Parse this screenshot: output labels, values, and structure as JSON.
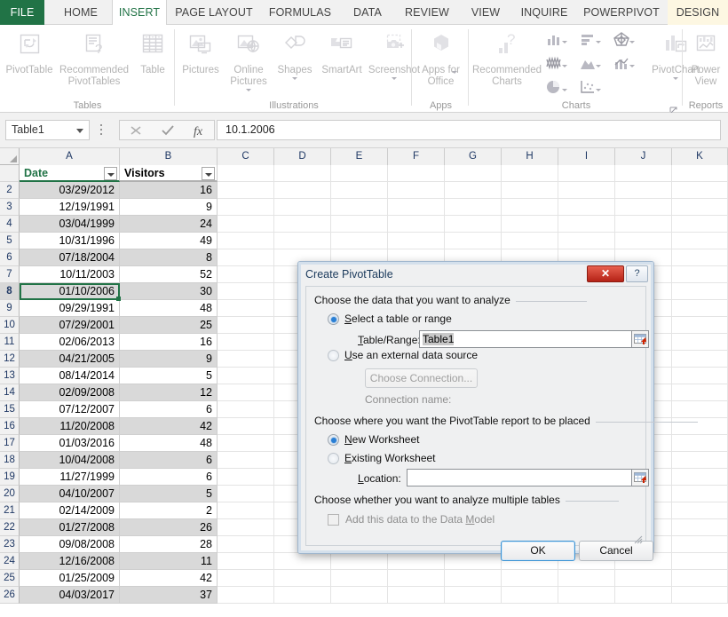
{
  "ribbon": {
    "tabs": [
      {
        "label": "FILE",
        "state": "file"
      },
      {
        "label": "HOME",
        "state": "normal"
      },
      {
        "label": "INSERT",
        "state": "active"
      },
      {
        "label": "PAGE LAYOUT",
        "state": "normal"
      },
      {
        "label": "FORMULAS",
        "state": "normal"
      },
      {
        "label": "DATA",
        "state": "normal"
      },
      {
        "label": "REVIEW",
        "state": "normal"
      },
      {
        "label": "VIEW",
        "state": "normal"
      },
      {
        "label": "INQUIRE",
        "state": "normal"
      },
      {
        "label": "POWERPIVOT",
        "state": "normal"
      },
      {
        "label": "DESIGN",
        "state": "contextual"
      }
    ],
    "groups": [
      {
        "name": "Tables",
        "label": "Tables"
      },
      {
        "name": "Illustrations",
        "label": "Illustrations"
      },
      {
        "name": "Apps",
        "label": "Apps"
      },
      {
        "name": "Charts",
        "label": "Charts"
      },
      {
        "name": "Reports",
        "label": "Reports"
      }
    ],
    "buttons": {
      "pivottable": "PivotTable",
      "recommended_pivottables_l1": "Recommended",
      "recommended_pivottables_l2": "PivotTables",
      "table": "Table",
      "pictures": "Pictures",
      "online_pictures_l1": "Online",
      "online_pictures_l2": "Pictures",
      "shapes": "Shapes",
      "smartart": "SmartArt",
      "screenshot": "Screenshot",
      "apps_for_office_l1": "Apps for",
      "apps_for_office_l2": "Office",
      "recommended_charts_l1": "Recommended",
      "recommended_charts_l2": "Charts",
      "pivotchart": "PivotChart",
      "power_view_l1": "Power",
      "power_view_l2": "View"
    }
  },
  "formula_bar": {
    "name_box_value": "Table1",
    "cell_value": "10.1.2006",
    "cancel_icon": "cancel-icon",
    "enter_icon": "enter-icon",
    "function_icon": "insert-function-icon"
  },
  "grid": {
    "column_headers": [
      "A",
      "B",
      "C",
      "D",
      "E",
      "F",
      "G",
      "H",
      "I",
      "J",
      "K"
    ],
    "table_headers": [
      "Date",
      "Visitors"
    ],
    "selected_cell_row": 8,
    "rows": [
      {
        "n": "2",
        "date": "03/29/2012",
        "visitors": "16"
      },
      {
        "n": "3",
        "date": "12/19/1991",
        "visitors": "9"
      },
      {
        "n": "4",
        "date": "03/04/1999",
        "visitors": "24"
      },
      {
        "n": "5",
        "date": "10/31/1996",
        "visitors": "49"
      },
      {
        "n": "6",
        "date": "07/18/2004",
        "visitors": "8"
      },
      {
        "n": "7",
        "date": "10/11/2003",
        "visitors": "52"
      },
      {
        "n": "8",
        "date": "01/10/2006",
        "visitors": "30"
      },
      {
        "n": "9",
        "date": "09/29/1991",
        "visitors": "48"
      },
      {
        "n": "10",
        "date": "07/29/2001",
        "visitors": "25"
      },
      {
        "n": "11",
        "date": "02/06/2013",
        "visitors": "16"
      },
      {
        "n": "12",
        "date": "04/21/2005",
        "visitors": "9"
      },
      {
        "n": "13",
        "date": "08/14/2014",
        "visitors": "5"
      },
      {
        "n": "14",
        "date": "02/09/2008",
        "visitors": "12"
      },
      {
        "n": "15",
        "date": "07/12/2007",
        "visitors": "6"
      },
      {
        "n": "16",
        "date": "11/20/2008",
        "visitors": "42"
      },
      {
        "n": "17",
        "date": "01/03/2016",
        "visitors": "48"
      },
      {
        "n": "18",
        "date": "10/04/2008",
        "visitors": "6"
      },
      {
        "n": "19",
        "date": "11/27/1999",
        "visitors": "6"
      },
      {
        "n": "20",
        "date": "04/10/2007",
        "visitors": "5"
      },
      {
        "n": "21",
        "date": "02/14/2009",
        "visitors": "2"
      },
      {
        "n": "22",
        "date": "01/27/2008",
        "visitors": "26"
      },
      {
        "n": "23",
        "date": "09/08/2008",
        "visitors": "28"
      },
      {
        "n": "24",
        "date": "12/16/2008",
        "visitors": "11"
      },
      {
        "n": "25",
        "date": "01/25/2009",
        "visitors": "42"
      },
      {
        "n": "26",
        "date": "04/03/2017",
        "visitors": "37"
      }
    ]
  },
  "dialog": {
    "title": "Create PivotTable",
    "help_label": "?",
    "close_label": "✕",
    "section1_label": "Choose the data that you want to analyze",
    "radio_select_range": "Select a table or range",
    "table_range_label": "Table/Range:",
    "table_range_value": "Table1",
    "radio_external": "Use an external data source",
    "choose_connection_label": "Choose Connection...",
    "connection_name_label": "Connection name:",
    "section2_label": "Choose where you want the PivotTable report to be placed",
    "radio_new_worksheet": "New Worksheet",
    "radio_existing_worksheet": "Existing Worksheet",
    "location_label": "Location:",
    "location_value": "",
    "section3_label": "Choose whether you want to analyze multiple tables",
    "checkbox_data_model": "Add this data to the Data Model",
    "ok_label": "OK",
    "cancel_label": "Cancel"
  },
  "colors": {
    "excel_green": "#217346",
    "accent_blue": "#2a7fd4",
    "contextual_tab": "#fdf7e2",
    "close_red": "#b42216"
  }
}
